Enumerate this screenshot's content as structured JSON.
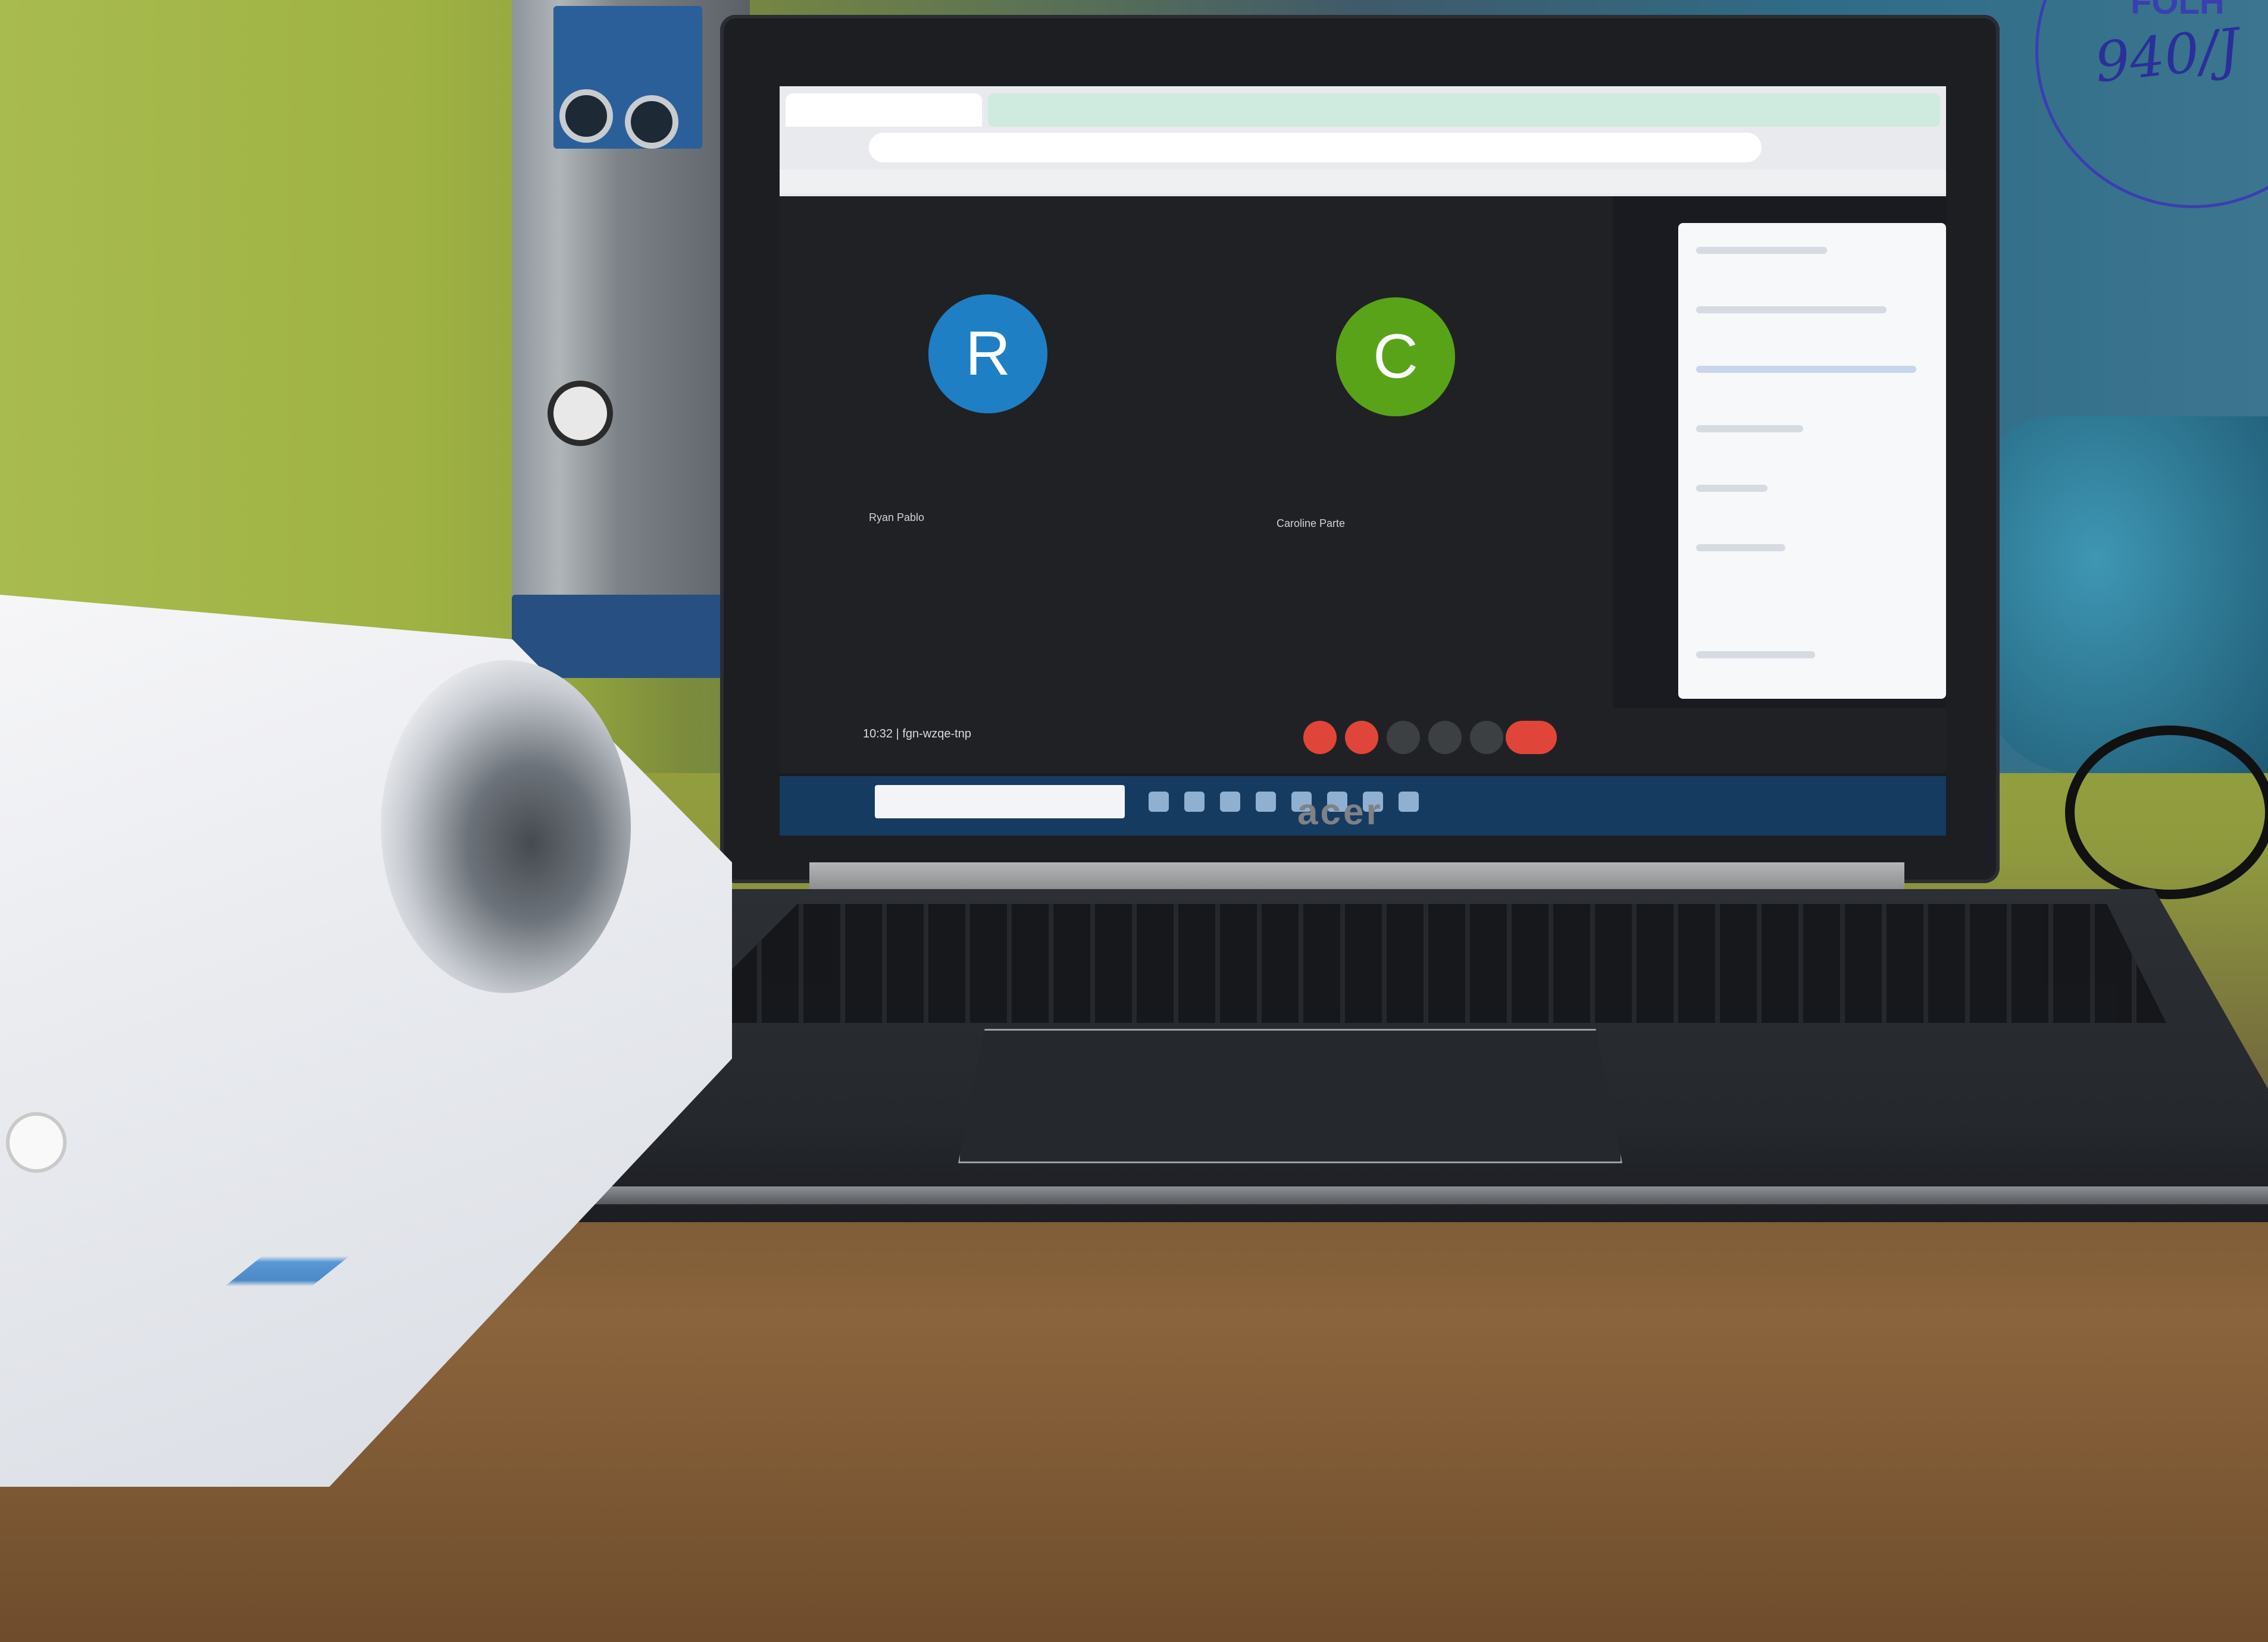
{
  "photo": {
    "description": ""
  },
  "laptop": {
    "brand": "acer",
    "screen": {
      "participants": [
        {
          "initial": "R",
          "name": "Ryan Pablo",
          "color": "#1f7fc4"
        },
        {
          "initial": "C",
          "name": "Caroline Parte",
          "color": "#59a319"
        }
      ],
      "clock": "10:32  |  fgn-wzqe-tnp"
    }
  },
  "stamp": {
    "handwritten": "940/J",
    "top_text": "FOLH"
  }
}
